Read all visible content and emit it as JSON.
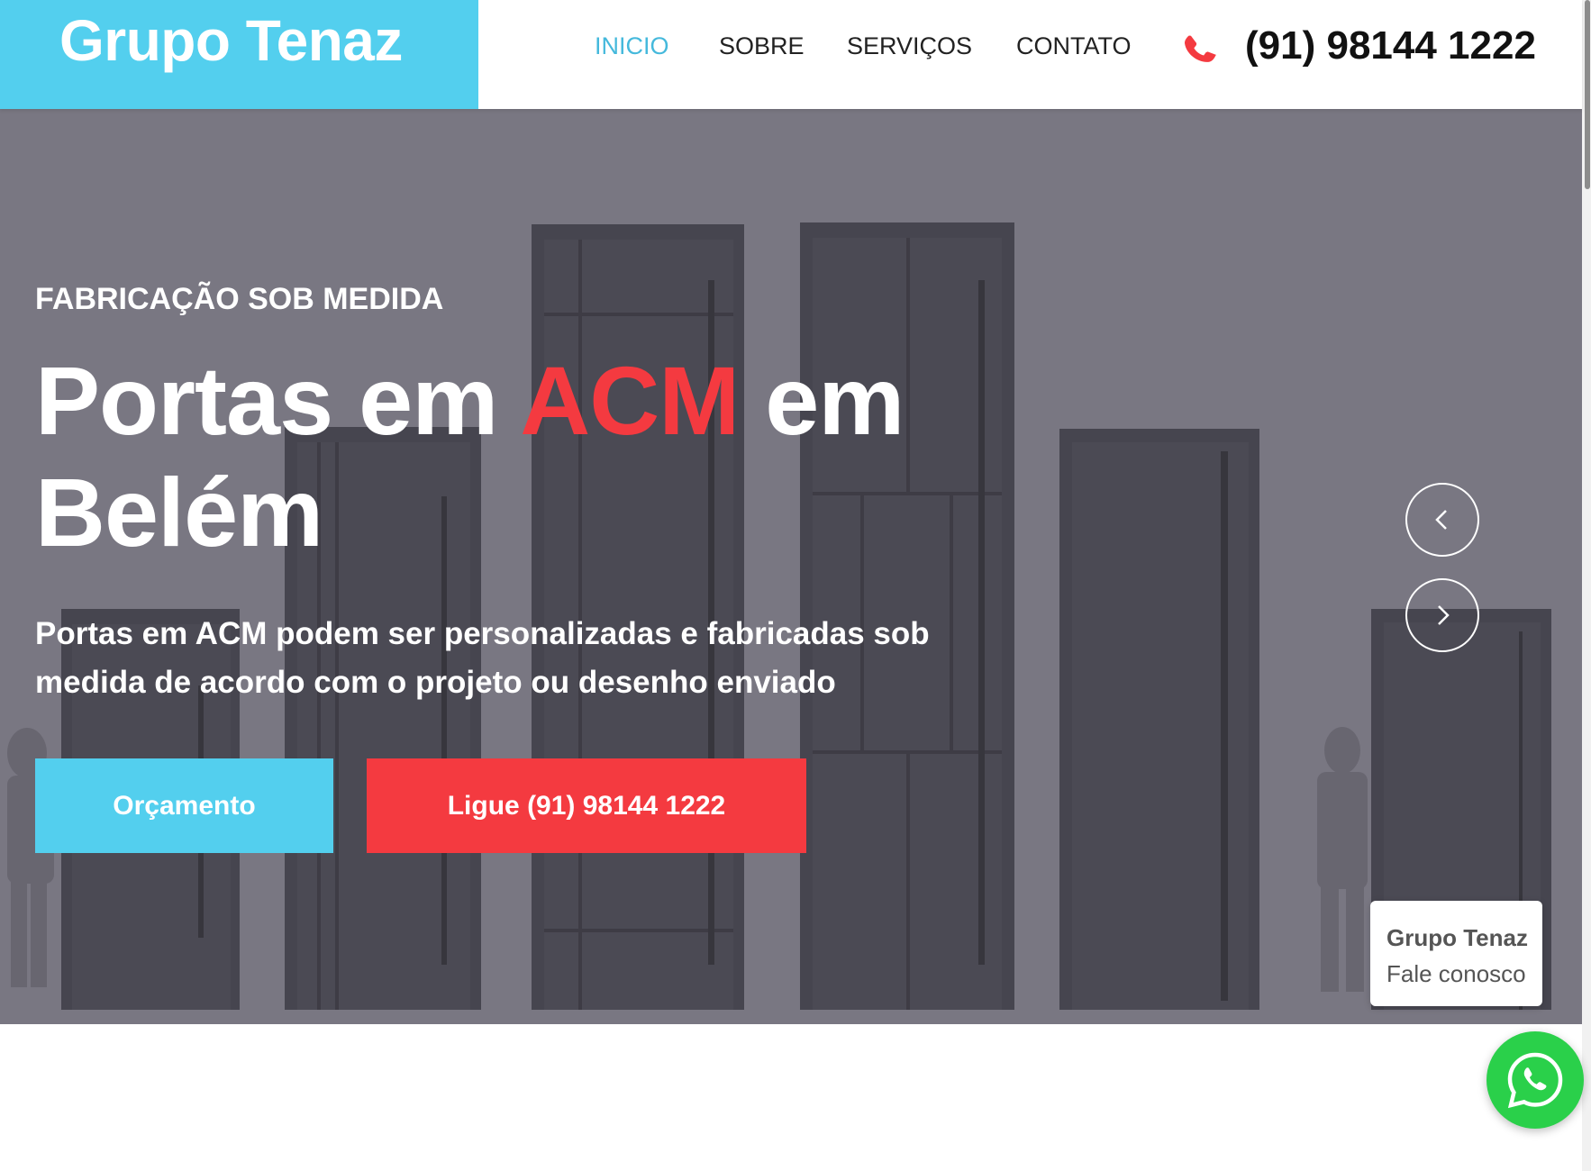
{
  "header": {
    "brand": "Grupo Tenaz",
    "nav": [
      {
        "label": "INICIO",
        "active": true
      },
      {
        "label": "SOBRE",
        "active": false
      },
      {
        "label": "SERVIÇOS",
        "active": false
      },
      {
        "label": "CONTATO",
        "active": false
      }
    ],
    "phone_icon": "phone-icon",
    "phone": "(91) 98144 1222"
  },
  "hero": {
    "eyebrow": "FABRICAÇÃO SOB MEDIDA",
    "headline_before": "Portas em ",
    "headline_accent": "ACM",
    "headline_after": " em Belém",
    "subtitle": "Portas em ACM podem ser personalizadas e fabricadas sob medida de acordo com o projeto ou desenho enviado",
    "quote_button": "Orçamento",
    "call_button": "Ligue (91) 98144 1222",
    "prev_icon": "chevron-left-icon",
    "next_icon": "chevron-right-icon"
  },
  "chat": {
    "name": "Grupo Tenaz",
    "tagline": "Fale conosco",
    "whatsapp_icon": "whatsapp-icon"
  },
  "colors": {
    "brand_blue": "#53cfee",
    "accent_red": "#f43a40",
    "nav_active": "#45b9dc",
    "whatsapp_green": "#2ad04a"
  }
}
